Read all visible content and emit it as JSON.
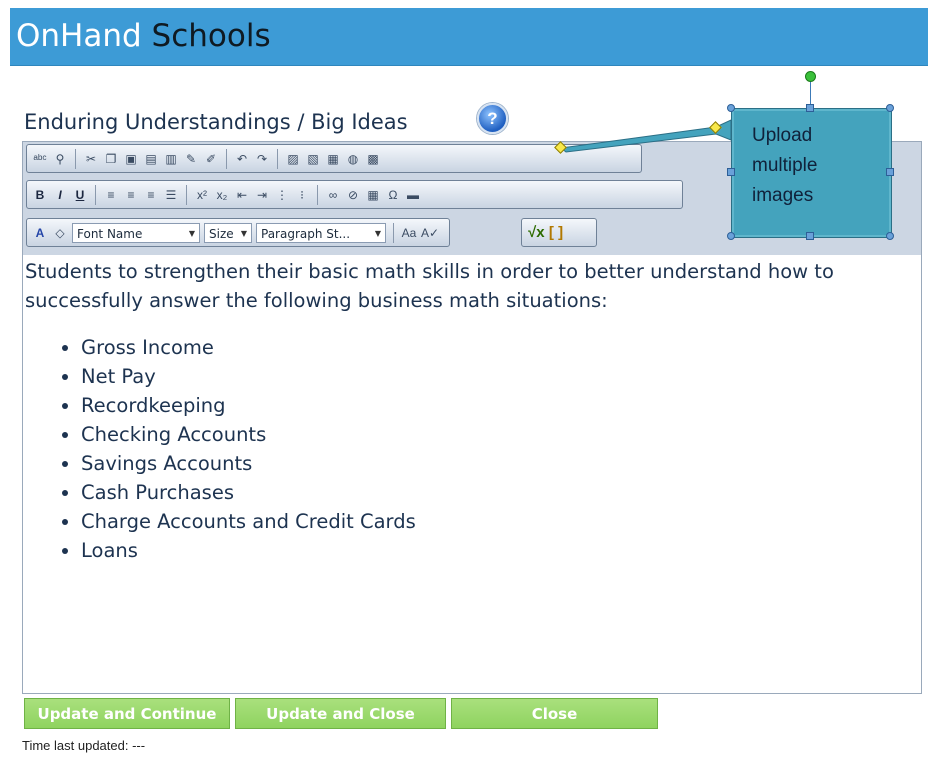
{
  "header": {
    "brand_part1": "OnHand",
    "brand_part2": " Schools"
  },
  "section": {
    "title": "Enduring Understandings / Big Ideas",
    "help_symbol": "?"
  },
  "toolbar": {
    "font_name": "Font Name",
    "size": "Size",
    "paragraph_style": "Paragraph St...",
    "icons_row1": [
      "spellcheck-icon",
      "find-icon",
      "cut-icon",
      "copy-icon",
      "paste-icon",
      "paste-plain-icon",
      "paste-word-icon",
      "format-stripper-icon",
      "clear-format-icon",
      "undo-icon",
      "redo-icon",
      "image-icon",
      "image-manager-icon",
      "multi-image-upload-icon",
      "flash-icon",
      "media-icon"
    ],
    "icons_row2": [
      "bold-icon",
      "italic-icon",
      "underline-icon",
      "align-left-icon",
      "align-center-icon",
      "align-right-icon",
      "justify-icon",
      "superscript-icon",
      "subscript-icon",
      "outdent-icon",
      "indent-icon",
      "numbered-list-icon",
      "bulleted-list-icon",
      "link-icon",
      "unlink-icon",
      "table-icon",
      "symbol-icon",
      "horizontal-rule-icon"
    ],
    "icons_row3": [
      "font-color-icon",
      "highlight-color-icon",
      "text-case-icon",
      "spell-tool-icon",
      "equation-icon",
      "bracket-icon"
    ]
  },
  "content": {
    "intro": "Students to strengthen their basic math skills in order to better understand how to successfully answer the following business math situations:",
    "items": [
      "Gross Income",
      "Net Pay",
      "Recordkeeping",
      "Checking Accounts",
      "Savings Accounts",
      "Cash Purchases",
      "Charge Accounts and Credit Cards",
      "Loans"
    ]
  },
  "callout": {
    "text_line1": "Upload",
    "text_line2": "multiple",
    "text_line3": "images"
  },
  "buttons": {
    "update_continue": "Update and Continue",
    "update_close": "Update and Close",
    "close": "Close"
  },
  "footer": {
    "time_label": "Time last updated: ---"
  },
  "colors": {
    "banner": "#3d9bd6",
    "callout": "#44a3bd",
    "button": "#96d666",
    "text": "#1d3350"
  }
}
